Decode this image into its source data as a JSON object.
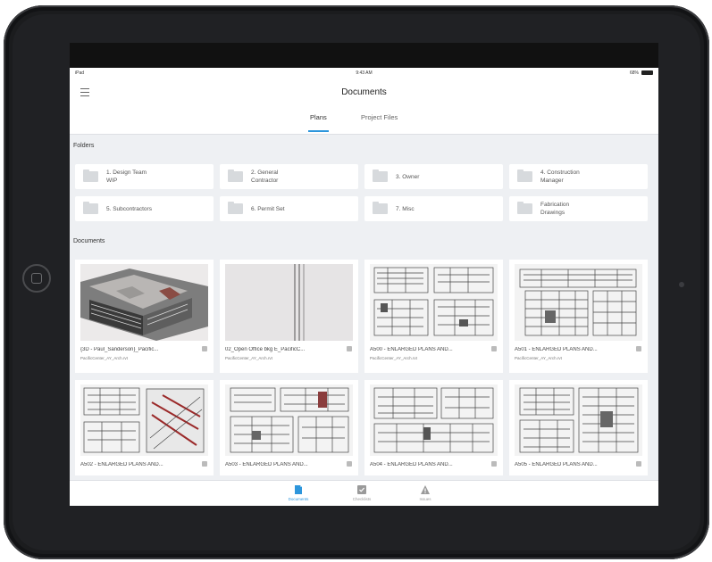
{
  "status": {
    "carrier": "iPad",
    "time": "9:43 AM",
    "battery": "68%"
  },
  "header": {
    "title": "Documents",
    "tabs": [
      {
        "label": "Plans"
      },
      {
        "label": "Project Files"
      }
    ]
  },
  "folders_label": "Folders",
  "folders": [
    {
      "name": "1. Design Team\nWIP"
    },
    {
      "name": "2. General\nContractor"
    },
    {
      "name": "3. Owner"
    },
    {
      "name": "4. Construction\nManager"
    },
    {
      "name": "5. Subcontractors"
    },
    {
      "name": "6. Permit Set"
    },
    {
      "name": "7. Misc"
    },
    {
      "name": "Fabrication\nDrawings"
    }
  ],
  "documents_label": "Documents",
  "documents": [
    {
      "name": "{3D - Paul_Sanderson}_Pacific...",
      "file": "PacificCenter_AY_Arch.rvt"
    },
    {
      "name": "02_Open Office bkg E_PacificC...",
      "file": "PacificCenter_AY_Arch.rvt"
    },
    {
      "name": "A500 - ENLARGED PLANS AND...",
      "file": "PacificCenter_AY_Arch.rvt"
    },
    {
      "name": "A501 - ENLARGED PLANS AND...",
      "file": "PacificCenter_AY_Arch.rvt"
    },
    {
      "name": "A502 - ENLARGED PLANS AND...",
      "file": ""
    },
    {
      "name": "A503 - ENLARGED PLANS AND...",
      "file": ""
    },
    {
      "name": "A504 - ENLARGED PLANS AND...",
      "file": ""
    },
    {
      "name": "A505 - ENLARGED PLANS AND...",
      "file": ""
    }
  ],
  "tabbar": [
    {
      "label": "Documents",
      "icon": "document-icon"
    },
    {
      "label": "Checklists",
      "icon": "checklist-icon"
    },
    {
      "label": "Issues",
      "icon": "warning-icon"
    }
  ],
  "colors": {
    "accent": "#2d96dc",
    "background": "#eef0f3"
  }
}
